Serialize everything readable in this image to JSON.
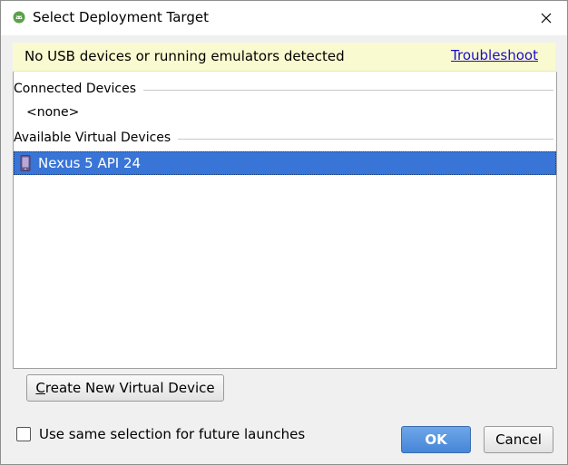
{
  "window": {
    "title": "Select Deployment Target",
    "title_icon": "android-studio-icon",
    "close_icon": "close-icon"
  },
  "banner": {
    "message": "No USB devices or running emulators detected",
    "link_label": "Troubleshoot",
    "background_color": "#fafad0",
    "link_color": "#1a0dcc"
  },
  "devices": {
    "connected_header": "Connected Devices",
    "connected_empty": "<none>",
    "available_header": "Available Virtual Devices",
    "available_items": [
      {
        "label": "Nexus 5 API 24",
        "icon": "phone-device-icon",
        "selected": true
      }
    ],
    "selection_color": "#3875d7"
  },
  "actions": {
    "create_virtual_device_label": "Create New Virtual Device",
    "create_mnemonic": "C",
    "same_selection_label": "Use same selection for future launches",
    "same_selection_checked": false,
    "ok_label": "OK",
    "cancel_label": "Cancel",
    "ok_color": "#4686d8"
  }
}
